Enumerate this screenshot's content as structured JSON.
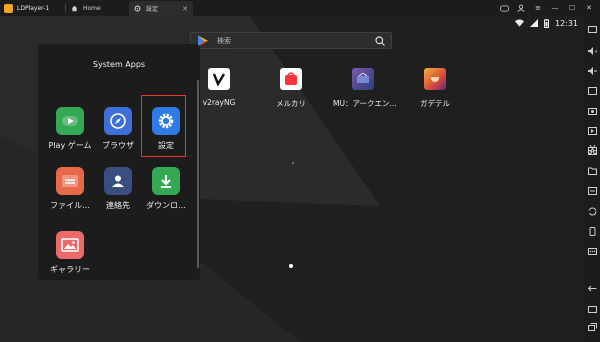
{
  "window": {
    "app_title": "LDPlayer-1",
    "tabs": [
      {
        "label": "Home",
        "icon": "home-icon"
      },
      {
        "label": "設定",
        "icon": "settings-gear-icon"
      }
    ],
    "controls": [
      "gamepad-icon",
      "account-icon",
      "menu-icon",
      "minimize-icon",
      "maximize-icon",
      "close-icon"
    ]
  },
  "status_bar": {
    "time": "12:31",
    "icons": [
      "wifi-icon",
      "signal-icon",
      "battery-icon"
    ]
  },
  "search": {
    "placeholder": "検索"
  },
  "desktop_apps": [
    {
      "label": "v2rayNG",
      "icon": "v2rayng-icon",
      "color": "#ffffff"
    },
    {
      "label": "メルカリ",
      "icon": "mercari-icon",
      "color": "#ffffff"
    },
    {
      "label": "MU：アークエン...",
      "icon": "mu-archangel-icon",
      "color": "#7a5aa8"
    },
    {
      "label": "ガデテル",
      "icon": "guardian-tales-icon",
      "color": "#d9483b"
    }
  ],
  "system_apps": {
    "title": "System Apps",
    "items": [
      {
        "label": "Play ゲーム",
        "icon": "play-games-icon",
        "color": "#34a853"
      },
      {
        "label": "ブラウザ",
        "icon": "browser-icon",
        "color": "#3f6fd8"
      },
      {
        "label": "設定",
        "icon": "settings-icon",
        "color": "#2f7be5"
      },
      {
        "label": "ファイル...",
        "icon": "file-manager-icon",
        "color": "#e8694a"
      },
      {
        "label": "連絡先",
        "icon": "contacts-icon",
        "color": "#3a4f80"
      },
      {
        "label": "ダウンロ...",
        "icon": "downloads-icon",
        "color": "#34a853"
      },
      {
        "label": "ギャラリー",
        "icon": "gallery-icon",
        "color": "#ec6a6a"
      }
    ]
  },
  "right_toolbar": [
    "keyboard-icon",
    "volume-up-icon",
    "volume-down-icon",
    "screen-resize-icon",
    "screenshot-icon",
    "record-icon",
    "add-apk-icon",
    "folder-icon",
    "scissors-icon",
    "operation-recorder-icon",
    "sync-icon",
    "rotate-icon",
    "settings-icon",
    "more-icon",
    "back-icon",
    "home-button-icon",
    "recent-apps-icon"
  ]
}
